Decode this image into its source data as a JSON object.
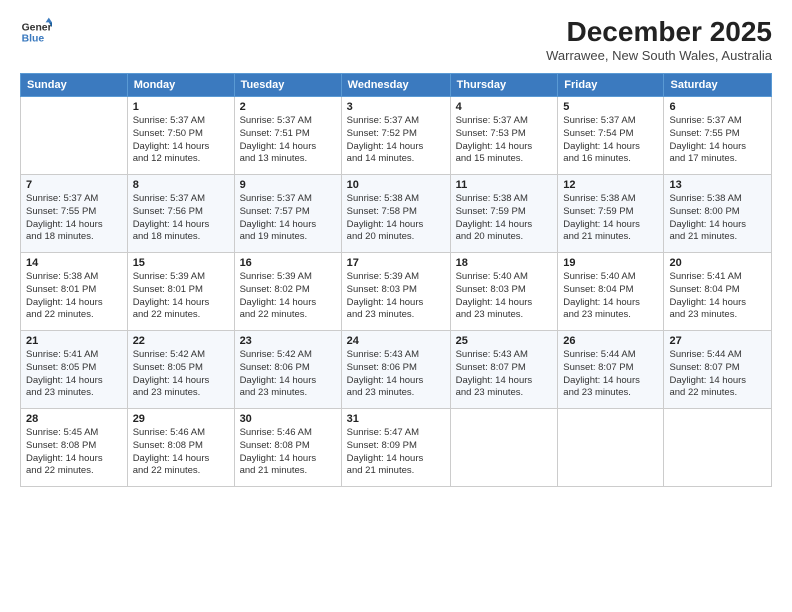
{
  "logo": {
    "line1": "General",
    "line2": "Blue"
  },
  "title": "December 2025",
  "subtitle": "Warrawee, New South Wales, Australia",
  "header_days": [
    "Sunday",
    "Monday",
    "Tuesday",
    "Wednesday",
    "Thursday",
    "Friday",
    "Saturday"
  ],
  "weeks": [
    [
      {
        "day": "",
        "info": ""
      },
      {
        "day": "1",
        "info": "Sunrise: 5:37 AM\nSunset: 7:50 PM\nDaylight: 14 hours\nand 12 minutes."
      },
      {
        "day": "2",
        "info": "Sunrise: 5:37 AM\nSunset: 7:51 PM\nDaylight: 14 hours\nand 13 minutes."
      },
      {
        "day": "3",
        "info": "Sunrise: 5:37 AM\nSunset: 7:52 PM\nDaylight: 14 hours\nand 14 minutes."
      },
      {
        "day": "4",
        "info": "Sunrise: 5:37 AM\nSunset: 7:53 PM\nDaylight: 14 hours\nand 15 minutes."
      },
      {
        "day": "5",
        "info": "Sunrise: 5:37 AM\nSunset: 7:54 PM\nDaylight: 14 hours\nand 16 minutes."
      },
      {
        "day": "6",
        "info": "Sunrise: 5:37 AM\nSunset: 7:55 PM\nDaylight: 14 hours\nand 17 minutes."
      }
    ],
    [
      {
        "day": "7",
        "info": "Sunrise: 5:37 AM\nSunset: 7:55 PM\nDaylight: 14 hours\nand 18 minutes."
      },
      {
        "day": "8",
        "info": "Sunrise: 5:37 AM\nSunset: 7:56 PM\nDaylight: 14 hours\nand 18 minutes."
      },
      {
        "day": "9",
        "info": "Sunrise: 5:37 AM\nSunset: 7:57 PM\nDaylight: 14 hours\nand 19 minutes."
      },
      {
        "day": "10",
        "info": "Sunrise: 5:38 AM\nSunset: 7:58 PM\nDaylight: 14 hours\nand 20 minutes."
      },
      {
        "day": "11",
        "info": "Sunrise: 5:38 AM\nSunset: 7:59 PM\nDaylight: 14 hours\nand 20 minutes."
      },
      {
        "day": "12",
        "info": "Sunrise: 5:38 AM\nSunset: 7:59 PM\nDaylight: 14 hours\nand 21 minutes."
      },
      {
        "day": "13",
        "info": "Sunrise: 5:38 AM\nSunset: 8:00 PM\nDaylight: 14 hours\nand 21 minutes."
      }
    ],
    [
      {
        "day": "14",
        "info": "Sunrise: 5:38 AM\nSunset: 8:01 PM\nDaylight: 14 hours\nand 22 minutes."
      },
      {
        "day": "15",
        "info": "Sunrise: 5:39 AM\nSunset: 8:01 PM\nDaylight: 14 hours\nand 22 minutes."
      },
      {
        "day": "16",
        "info": "Sunrise: 5:39 AM\nSunset: 8:02 PM\nDaylight: 14 hours\nand 22 minutes."
      },
      {
        "day": "17",
        "info": "Sunrise: 5:39 AM\nSunset: 8:03 PM\nDaylight: 14 hours\nand 23 minutes."
      },
      {
        "day": "18",
        "info": "Sunrise: 5:40 AM\nSunset: 8:03 PM\nDaylight: 14 hours\nand 23 minutes."
      },
      {
        "day": "19",
        "info": "Sunrise: 5:40 AM\nSunset: 8:04 PM\nDaylight: 14 hours\nand 23 minutes."
      },
      {
        "day": "20",
        "info": "Sunrise: 5:41 AM\nSunset: 8:04 PM\nDaylight: 14 hours\nand 23 minutes."
      }
    ],
    [
      {
        "day": "21",
        "info": "Sunrise: 5:41 AM\nSunset: 8:05 PM\nDaylight: 14 hours\nand 23 minutes."
      },
      {
        "day": "22",
        "info": "Sunrise: 5:42 AM\nSunset: 8:05 PM\nDaylight: 14 hours\nand 23 minutes."
      },
      {
        "day": "23",
        "info": "Sunrise: 5:42 AM\nSunset: 8:06 PM\nDaylight: 14 hours\nand 23 minutes."
      },
      {
        "day": "24",
        "info": "Sunrise: 5:43 AM\nSunset: 8:06 PM\nDaylight: 14 hours\nand 23 minutes."
      },
      {
        "day": "25",
        "info": "Sunrise: 5:43 AM\nSunset: 8:07 PM\nDaylight: 14 hours\nand 23 minutes."
      },
      {
        "day": "26",
        "info": "Sunrise: 5:44 AM\nSunset: 8:07 PM\nDaylight: 14 hours\nand 23 minutes."
      },
      {
        "day": "27",
        "info": "Sunrise: 5:44 AM\nSunset: 8:07 PM\nDaylight: 14 hours\nand 22 minutes."
      }
    ],
    [
      {
        "day": "28",
        "info": "Sunrise: 5:45 AM\nSunset: 8:08 PM\nDaylight: 14 hours\nand 22 minutes."
      },
      {
        "day": "29",
        "info": "Sunrise: 5:46 AM\nSunset: 8:08 PM\nDaylight: 14 hours\nand 22 minutes."
      },
      {
        "day": "30",
        "info": "Sunrise: 5:46 AM\nSunset: 8:08 PM\nDaylight: 14 hours\nand 21 minutes."
      },
      {
        "day": "31",
        "info": "Sunrise: 5:47 AM\nSunset: 8:09 PM\nDaylight: 14 hours\nand 21 minutes."
      },
      {
        "day": "",
        "info": ""
      },
      {
        "day": "",
        "info": ""
      },
      {
        "day": "",
        "info": ""
      }
    ]
  ]
}
